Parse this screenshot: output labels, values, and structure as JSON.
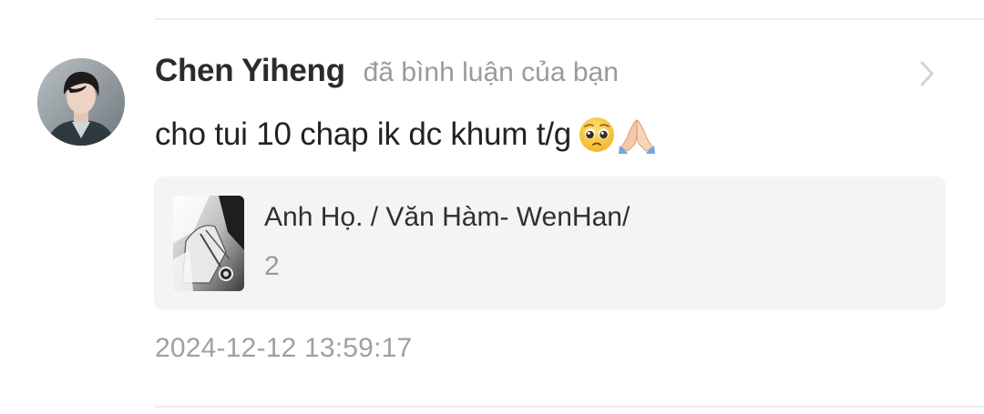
{
  "comment": {
    "username": "Chen Yiheng",
    "action": "đã bình luận của bạn",
    "text": "cho tui 10 chap ik dc khum t/g",
    "emojis": [
      "pleading-face-emoji",
      "folded-hands-emoji"
    ]
  },
  "referenced_post": {
    "title": "Anh Họ. / Văn Hàm- WenHan/",
    "count": "2"
  },
  "timestamp": "2024-12-12 13:59:17",
  "colors": {
    "username": "#2b2b2b",
    "secondary_text": "#9a9a9a",
    "card_background": "#f4f4f5",
    "divider": "#ececec"
  }
}
